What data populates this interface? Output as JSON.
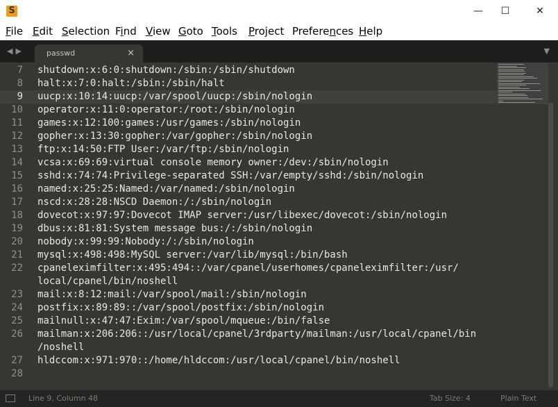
{
  "window": {
    "app_icon": "sublime-text-icon",
    "app_icon_glyph": "S",
    "minimize_glyph": "—",
    "maximize_glyph": "☐",
    "close_glyph": "✕"
  },
  "menu": {
    "file": {
      "key": "F",
      "rest": "ile"
    },
    "edit": {
      "key": "E",
      "rest": "dit"
    },
    "selection": {
      "key": "S",
      "rest": "election"
    },
    "find": {
      "pre": "F",
      "key": "i",
      "rest": "nd"
    },
    "view": {
      "key": "V",
      "rest": "iew"
    },
    "goto": {
      "key": "G",
      "rest": "oto"
    },
    "tools": {
      "key": "T",
      "rest": "ools"
    },
    "project": {
      "key": "P",
      "rest": "roject"
    },
    "preferences": {
      "key": "n",
      "pre": "Prefere",
      "rest": "ces"
    },
    "help": {
      "key": "H",
      "rest": "elp"
    }
  },
  "tabbar": {
    "nav_glyph": "◀▶",
    "tab_title": "passwd",
    "tab_close": "×",
    "dropdown_glyph": "▼"
  },
  "editor": {
    "current_line": 9,
    "lines": [
      {
        "num": "7",
        "text": "shutdown:x:6:0:shutdown:/sbin:/sbin/shutdown"
      },
      {
        "num": "8",
        "text": "halt:x:7:0:halt:/sbin:/sbin/halt"
      },
      {
        "num": "9",
        "text": "uucp:x:10:14:uucp:/var/spool/uucp:/sbin/nologin"
      },
      {
        "num": "10",
        "text": "operator:x:11:0:operator:/root:/sbin/nologin"
      },
      {
        "num": "11",
        "text": "games:x:12:100:games:/usr/games:/sbin/nologin"
      },
      {
        "num": "12",
        "text": "gopher:x:13:30:gopher:/var/gopher:/sbin/nologin"
      },
      {
        "num": "13",
        "text": "ftp:x:14:50:FTP User:/var/ftp:/sbin/nologin"
      },
      {
        "num": "14",
        "text": "vcsa:x:69:69:virtual console memory owner:/dev:/sbin/nologin"
      },
      {
        "num": "15",
        "text": "sshd:x:74:74:Privilege-separated SSH:/var/empty/sshd:/sbin/nologin"
      },
      {
        "num": "16",
        "text": "named:x:25:25:Named:/var/named:/sbin/nologin"
      },
      {
        "num": "17",
        "text": "nscd:x:28:28:NSCD Daemon:/:/sbin/nologin"
      },
      {
        "num": "18",
        "text": "dovecot:x:97:97:Dovecot IMAP server:/usr/libexec/dovecot:/sbin/nologin"
      },
      {
        "num": "19",
        "text": "dbus:x:81:81:System message bus:/:/sbin/nologin"
      },
      {
        "num": "20",
        "text": "nobody:x:99:99:Nobody:/:/sbin/nologin"
      },
      {
        "num": "21",
        "text": "mysql:x:498:498:MySQL server:/var/lib/mysql:/bin/bash"
      },
      {
        "num": "22",
        "text": "cpaneleximfilter:x:495:494::/var/cpanel/userhomes/cpaneleximfilter:/usr/"
      },
      {
        "num": "",
        "text": "local/cpanel/bin/noshell"
      },
      {
        "num": "23",
        "text": "mail:x:8:12:mail:/var/spool/mail:/sbin/nologin"
      },
      {
        "num": "24",
        "text": "postfix:x:89:89::/var/spool/postfix:/sbin/nologin"
      },
      {
        "num": "25",
        "text": "mailnull:x:47:47:Exim:/var/spool/mqueue:/bin/false"
      },
      {
        "num": "26",
        "text": "mailman:x:206:206::/usr/local/cpanel/3rdparty/mailman:/usr/local/cpanel/bin"
      },
      {
        "num": "",
        "text": "/noshell"
      },
      {
        "num": "27",
        "text": "hldccom:x:971:970::/home/hldccom:/usr/local/cpanel/bin/noshell"
      },
      {
        "num": "28",
        "text": ""
      }
    ]
  },
  "status": {
    "position": "Line 9, Column 48",
    "tab_size": "Tab Size: 4",
    "syntax": "Plain Text"
  },
  "colors": {
    "editor_bg": "#363733",
    "tabbar_bg": "#1e1e1c",
    "status_bg": "#242422",
    "text": "#e8e8e2",
    "line_number": "#8f908a",
    "app_icon": "#f29a1a"
  }
}
